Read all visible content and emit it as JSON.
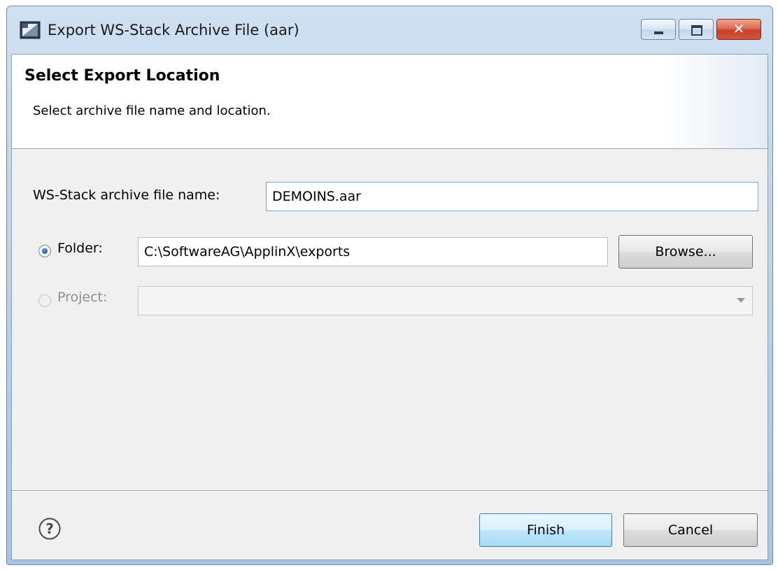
{
  "window": {
    "title": "Export WS-Stack Archive File (aar)",
    "close_glyph": "✕"
  },
  "banner": {
    "title": "Select Export Location",
    "description": "Select archive file name and location."
  },
  "form": {
    "archive_label": "WS-Stack archive file name:",
    "archive_value": "DEMOINS.aar",
    "folder_label": "Folder:",
    "folder_value": "C:\\SoftwareAG\\ApplinX\\exports",
    "folder_selected": true,
    "browse_label": "Browse...",
    "project_label": "Project:",
    "project_value": "",
    "project_enabled": false
  },
  "footer": {
    "help_icon": "help-icon",
    "finish_label": "Finish",
    "cancel_label": "Cancel"
  },
  "colors": {
    "accent": "#1d4e99",
    "default_button_border": "#3c7fb1",
    "close_button": "#c7402a"
  }
}
